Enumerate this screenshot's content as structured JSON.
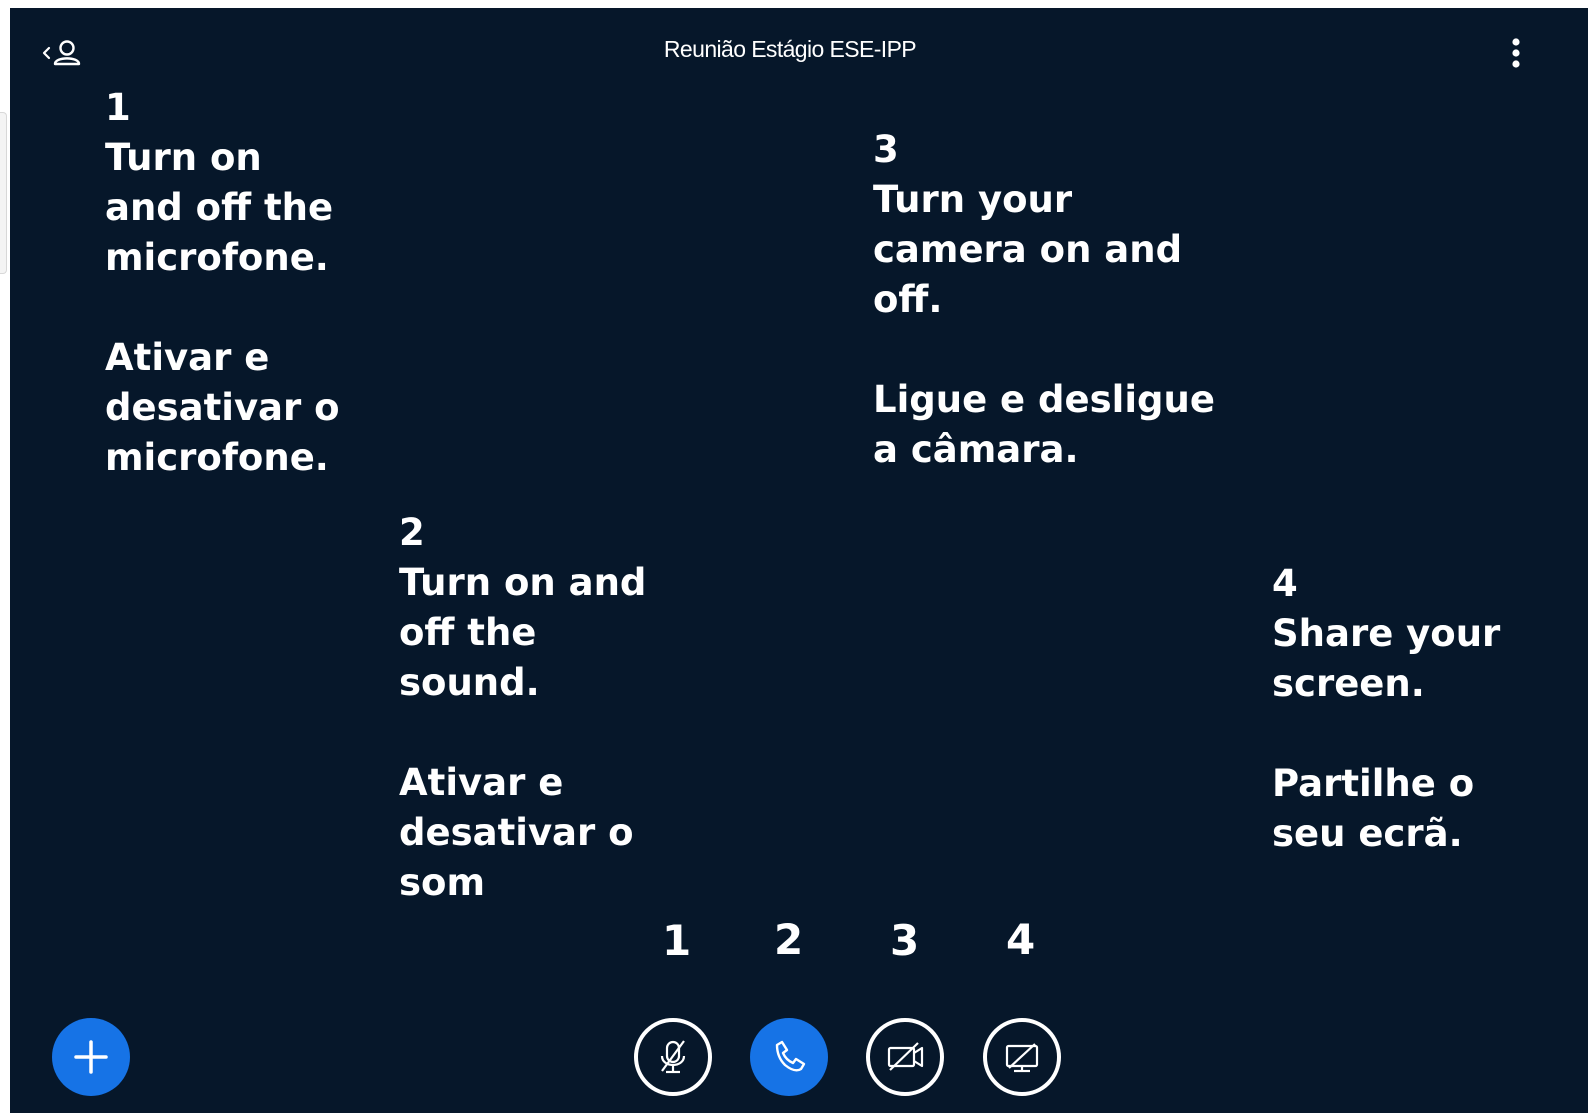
{
  "header": {
    "title": "Reunião Estágio ESE-IPP"
  },
  "notes": {
    "mic": "1\nTurn on\nand off the\nmicrofone.\n\nAtivar e\ndesativar o\nmicrofone.",
    "sound": "2\nTurn on and\noff the\nsound.\n\nAtivar e\ndesativar o\nsom",
    "camera": "3\nTurn your\ncamera on and\noff.\n\nLigue e desligue\na câmara.",
    "share": "4\nShare your\nscreen.\n\nPartilhe o\nseu ecrã."
  },
  "control_numbers": [
    "1",
    "2",
    "3",
    "4"
  ],
  "controls": {
    "add": "plus-icon",
    "microphone": "microphone-muted-icon",
    "audio": "phone-icon",
    "camera": "camera-off-icon",
    "share": "share-screen-icon"
  },
  "colors": {
    "background": "#06172a",
    "accent": "#1673e6",
    "text": "#ffffff"
  }
}
